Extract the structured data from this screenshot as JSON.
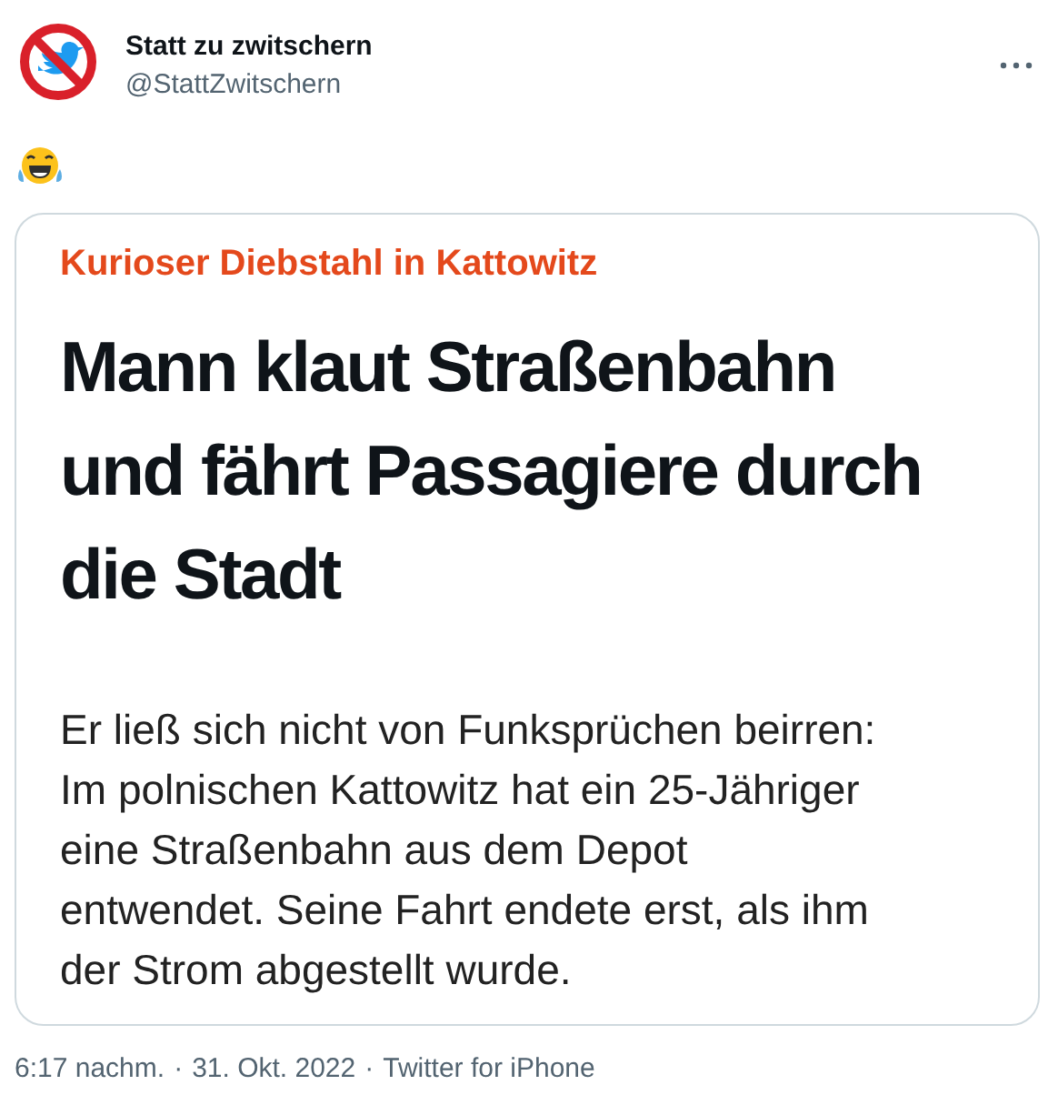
{
  "author": {
    "name": "Statt zu zwitschern",
    "handle": "@StattZwitschern"
  },
  "tweet": {
    "kind": "emoji"
  },
  "card": {
    "kicker": "Kurioser Diebstahl in Kattowitz",
    "headline_lines": [
      "Mann klaut Straßenbahn",
      "und fährt Passagiere durch",
      "die Stadt"
    ],
    "body_lines": [
      "Er ließ sich nicht von Funksprüchen beirren:",
      "Im polnischen Kattowitz hat ein 25-Jähriger",
      "eine Straßenbahn aus dem Depot",
      "entwendet. Seine Fahrt endete erst, als ihm",
      "der Strom abgestellt wurde."
    ]
  },
  "footer": {
    "time": "6:17 nachm.",
    "separator_1": "·",
    "date": "31. Okt. 2022",
    "separator_2": "·",
    "source": "Twitter for iPhone"
  }
}
